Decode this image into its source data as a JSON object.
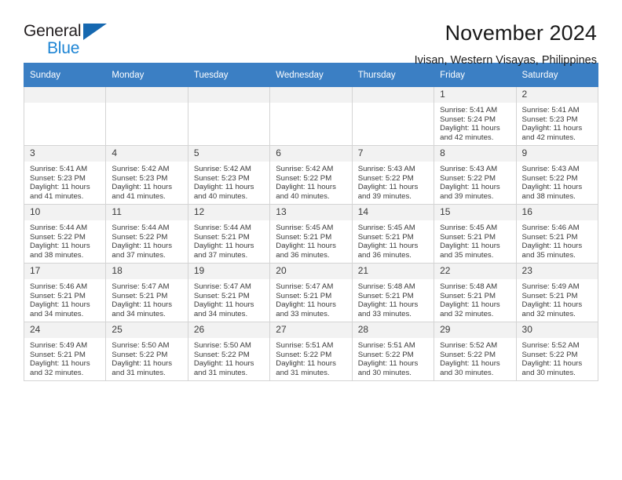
{
  "brand": {
    "line1": "General",
    "line2": "Blue",
    "triangle_color": "#1668b0",
    "blue_color": "#1c84d4"
  },
  "header": {
    "title": "November 2024",
    "subtitle": "Ivisan, Western Visayas, Philippines",
    "header_bg": "#3b7fc4"
  },
  "weekdays": [
    "Sunday",
    "Monday",
    "Tuesday",
    "Wednesday",
    "Thursday",
    "Friday",
    "Saturday"
  ],
  "labels": {
    "sunrise": "Sunrise:",
    "sunset": "Sunset:",
    "daylight": "Daylight:"
  },
  "weeks": [
    [
      {
        "empty": true
      },
      {
        "empty": true
      },
      {
        "empty": true
      },
      {
        "empty": true
      },
      {
        "empty": true
      },
      {
        "day": "1",
        "sunrise": "Sunrise: 5:41 AM",
        "sunset": "Sunset: 5:24 PM",
        "daylight1": "Daylight: 11 hours",
        "daylight2": "and 42 minutes."
      },
      {
        "day": "2",
        "sunrise": "Sunrise: 5:41 AM",
        "sunset": "Sunset: 5:23 PM",
        "daylight1": "Daylight: 11 hours",
        "daylight2": "and 42 minutes."
      }
    ],
    [
      {
        "day": "3",
        "sunrise": "Sunrise: 5:41 AM",
        "sunset": "Sunset: 5:23 PM",
        "daylight1": "Daylight: 11 hours",
        "daylight2": "and 41 minutes."
      },
      {
        "day": "4",
        "sunrise": "Sunrise: 5:42 AM",
        "sunset": "Sunset: 5:23 PM",
        "daylight1": "Daylight: 11 hours",
        "daylight2": "and 41 minutes."
      },
      {
        "day": "5",
        "sunrise": "Sunrise: 5:42 AM",
        "sunset": "Sunset: 5:23 PM",
        "daylight1": "Daylight: 11 hours",
        "daylight2": "and 40 minutes."
      },
      {
        "day": "6",
        "sunrise": "Sunrise: 5:42 AM",
        "sunset": "Sunset: 5:22 PM",
        "daylight1": "Daylight: 11 hours",
        "daylight2": "and 40 minutes."
      },
      {
        "day": "7",
        "sunrise": "Sunrise: 5:43 AM",
        "sunset": "Sunset: 5:22 PM",
        "daylight1": "Daylight: 11 hours",
        "daylight2": "and 39 minutes."
      },
      {
        "day": "8",
        "sunrise": "Sunrise: 5:43 AM",
        "sunset": "Sunset: 5:22 PM",
        "daylight1": "Daylight: 11 hours",
        "daylight2": "and 39 minutes."
      },
      {
        "day": "9",
        "sunrise": "Sunrise: 5:43 AM",
        "sunset": "Sunset: 5:22 PM",
        "daylight1": "Daylight: 11 hours",
        "daylight2": "and 38 minutes."
      }
    ],
    [
      {
        "day": "10",
        "sunrise": "Sunrise: 5:44 AM",
        "sunset": "Sunset: 5:22 PM",
        "daylight1": "Daylight: 11 hours",
        "daylight2": "and 38 minutes."
      },
      {
        "day": "11",
        "sunrise": "Sunrise: 5:44 AM",
        "sunset": "Sunset: 5:22 PM",
        "daylight1": "Daylight: 11 hours",
        "daylight2": "and 37 minutes."
      },
      {
        "day": "12",
        "sunrise": "Sunrise: 5:44 AM",
        "sunset": "Sunset: 5:21 PM",
        "daylight1": "Daylight: 11 hours",
        "daylight2": "and 37 minutes."
      },
      {
        "day": "13",
        "sunrise": "Sunrise: 5:45 AM",
        "sunset": "Sunset: 5:21 PM",
        "daylight1": "Daylight: 11 hours",
        "daylight2": "and 36 minutes."
      },
      {
        "day": "14",
        "sunrise": "Sunrise: 5:45 AM",
        "sunset": "Sunset: 5:21 PM",
        "daylight1": "Daylight: 11 hours",
        "daylight2": "and 36 minutes."
      },
      {
        "day": "15",
        "sunrise": "Sunrise: 5:45 AM",
        "sunset": "Sunset: 5:21 PM",
        "daylight1": "Daylight: 11 hours",
        "daylight2": "and 35 minutes."
      },
      {
        "day": "16",
        "sunrise": "Sunrise: 5:46 AM",
        "sunset": "Sunset: 5:21 PM",
        "daylight1": "Daylight: 11 hours",
        "daylight2": "and 35 minutes."
      }
    ],
    [
      {
        "day": "17",
        "sunrise": "Sunrise: 5:46 AM",
        "sunset": "Sunset: 5:21 PM",
        "daylight1": "Daylight: 11 hours",
        "daylight2": "and 34 minutes."
      },
      {
        "day": "18",
        "sunrise": "Sunrise: 5:47 AM",
        "sunset": "Sunset: 5:21 PM",
        "daylight1": "Daylight: 11 hours",
        "daylight2": "and 34 minutes."
      },
      {
        "day": "19",
        "sunrise": "Sunrise: 5:47 AM",
        "sunset": "Sunset: 5:21 PM",
        "daylight1": "Daylight: 11 hours",
        "daylight2": "and 34 minutes."
      },
      {
        "day": "20",
        "sunrise": "Sunrise: 5:47 AM",
        "sunset": "Sunset: 5:21 PM",
        "daylight1": "Daylight: 11 hours",
        "daylight2": "and 33 minutes."
      },
      {
        "day": "21",
        "sunrise": "Sunrise: 5:48 AM",
        "sunset": "Sunset: 5:21 PM",
        "daylight1": "Daylight: 11 hours",
        "daylight2": "and 33 minutes."
      },
      {
        "day": "22",
        "sunrise": "Sunrise: 5:48 AM",
        "sunset": "Sunset: 5:21 PM",
        "daylight1": "Daylight: 11 hours",
        "daylight2": "and 32 minutes."
      },
      {
        "day": "23",
        "sunrise": "Sunrise: 5:49 AM",
        "sunset": "Sunset: 5:21 PM",
        "daylight1": "Daylight: 11 hours",
        "daylight2": "and 32 minutes."
      }
    ],
    [
      {
        "day": "24",
        "sunrise": "Sunrise: 5:49 AM",
        "sunset": "Sunset: 5:21 PM",
        "daylight1": "Daylight: 11 hours",
        "daylight2": "and 32 minutes."
      },
      {
        "day": "25",
        "sunrise": "Sunrise: 5:50 AM",
        "sunset": "Sunset: 5:22 PM",
        "daylight1": "Daylight: 11 hours",
        "daylight2": "and 31 minutes."
      },
      {
        "day": "26",
        "sunrise": "Sunrise: 5:50 AM",
        "sunset": "Sunset: 5:22 PM",
        "daylight1": "Daylight: 11 hours",
        "daylight2": "and 31 minutes."
      },
      {
        "day": "27",
        "sunrise": "Sunrise: 5:51 AM",
        "sunset": "Sunset: 5:22 PM",
        "daylight1": "Daylight: 11 hours",
        "daylight2": "and 31 minutes."
      },
      {
        "day": "28",
        "sunrise": "Sunrise: 5:51 AM",
        "sunset": "Sunset: 5:22 PM",
        "daylight1": "Daylight: 11 hours",
        "daylight2": "and 30 minutes."
      },
      {
        "day": "29",
        "sunrise": "Sunrise: 5:52 AM",
        "sunset": "Sunset: 5:22 PM",
        "daylight1": "Daylight: 11 hours",
        "daylight2": "and 30 minutes."
      },
      {
        "day": "30",
        "sunrise": "Sunrise: 5:52 AM",
        "sunset": "Sunset: 5:22 PM",
        "daylight1": "Daylight: 11 hours",
        "daylight2": "and 30 minutes."
      }
    ]
  ]
}
